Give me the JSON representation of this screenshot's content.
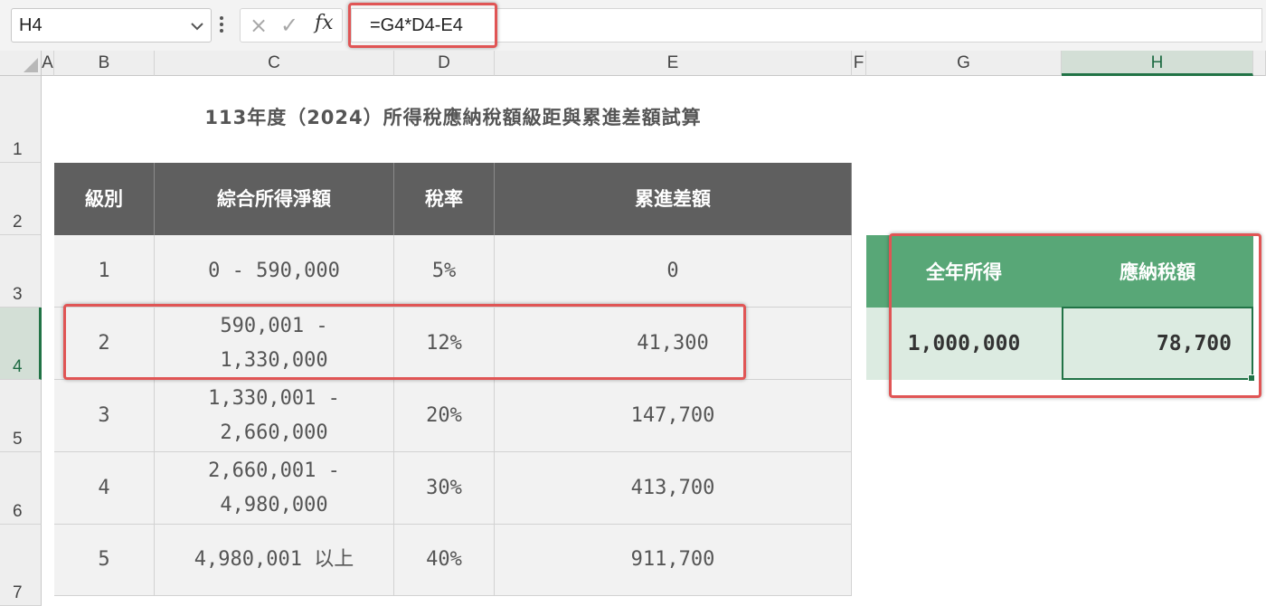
{
  "formula_bar": {
    "name_box": "H4",
    "dropdown_icon": "chevron-down-icon",
    "more_icon": "vertical-dots-icon",
    "cancel_icon": "×",
    "enter_icon": "✓",
    "fx_label": "fx",
    "formula": "=G4*D4-E4"
  },
  "columns": [
    "A",
    "B",
    "C",
    "D",
    "E",
    "F",
    "G",
    "H"
  ],
  "rows": [
    "1",
    "2",
    "3",
    "4",
    "5",
    "6",
    "7"
  ],
  "selected_cell": {
    "column": "H",
    "row": "4"
  },
  "title": "113年度（2024）所得稅應納稅額級距與累進差額試算",
  "tax_table": {
    "headers": [
      "級別",
      "綜合所得淨額",
      "稅率",
      "累進差額"
    ],
    "rows": [
      {
        "level": "1",
        "range_line1": "0 - 590,000",
        "range_line2": "",
        "rate": "5%",
        "deduction": "0"
      },
      {
        "level": "2",
        "range_line1": "590,001 -",
        "range_line2": "1,330,000",
        "rate": "12%",
        "deduction": "41,300"
      },
      {
        "level": "3",
        "range_line1": "1,330,001 -",
        "range_line2": "2,660,000",
        "rate": "20%",
        "deduction": "147,700"
      },
      {
        "level": "4",
        "range_line1": "2,660,001 -",
        "range_line2": "4,980,000",
        "rate": "30%",
        "deduction": "413,700"
      },
      {
        "level": "5",
        "range_line1": "4,980,001 以上",
        "range_line2": "",
        "rate": "40%",
        "deduction": "911,700"
      }
    ]
  },
  "result_table": {
    "income_header": "全年所得",
    "tax_header": "應納稅額",
    "income_value": "1,000,000",
    "tax_value": "78,700"
  },
  "colors": {
    "header_dark": "#5f5f5f",
    "header_green": "#58a777",
    "light_green": "#dcebe1",
    "excel_green": "#217346",
    "highlight_red": "#e05555"
  }
}
